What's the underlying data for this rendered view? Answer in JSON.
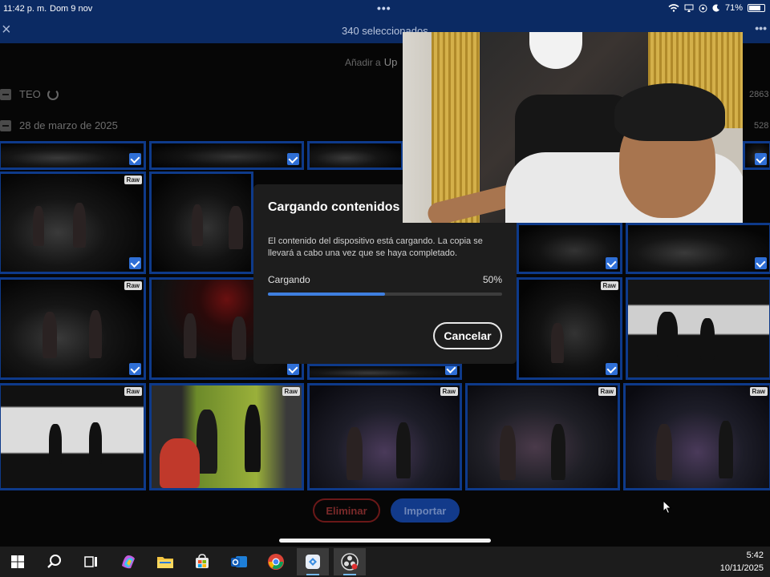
{
  "status_bar": {
    "time": "11:42 p. m.",
    "date": "Dom 9 nov",
    "dots": "•••",
    "battery": "71%"
  },
  "header": {
    "close_icon": "close-icon",
    "selected": "340 seleccionados",
    "more": "•••"
  },
  "toolbar": {
    "add_to": "Añadir a",
    "up": "Up"
  },
  "groups": [
    {
      "label": "TEO",
      "count": "2863"
    },
    {
      "label": "28 de marzo de 2025",
      "count": "528"
    }
  ],
  "photo_badge": "Raw",
  "dialog": {
    "title": "Cargando contenidos del",
    "body": "El contenido del dispositivo está cargando. La copia se llevará a cabo una vez que se haya completado.",
    "progress_label": "Cargando",
    "progress_pct": "50%",
    "progress_fraction": 0.5,
    "cancel": "Cancelar"
  },
  "actions": {
    "delete": "Eliminar",
    "import": "Importar"
  },
  "taskbar": {
    "clock_time": "5:42",
    "clock_date": "10/11/2025",
    "icons": [
      "windows-start-icon",
      "search-icon",
      "task-view-icon",
      "copilot-icon",
      "file-explorer-icon",
      "microsoft-store-icon",
      "outlook-icon",
      "chrome-icon",
      "app-icon",
      "obs-icon"
    ]
  },
  "colors": {
    "accent_blue": "#2f6fd6",
    "header_blue": "#0b2a63",
    "progress": "#3f7fe0",
    "delete_red": "#6a1818"
  }
}
